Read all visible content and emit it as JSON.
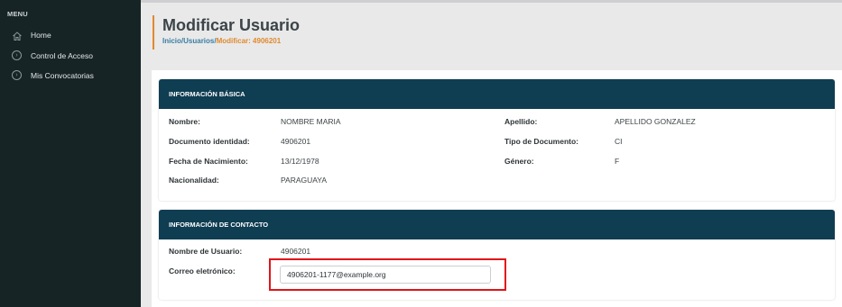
{
  "sidebar": {
    "menu_title": "MENU",
    "items": [
      {
        "label": "Home",
        "icon": "home-icon"
      },
      {
        "label": "Control de Acceso",
        "icon": "chevron-circle-icon"
      },
      {
        "label": "Mis Convocatorias",
        "icon": "chevron-circle-icon"
      }
    ]
  },
  "header": {
    "title": "Modificar Usuario",
    "breadcrumb": {
      "inicio": "Inicio",
      "sep": "/",
      "usuarios": "Usuarios",
      "current": "Modificar: 4906201"
    }
  },
  "basic_info": {
    "heading": "INFORMACIÓN BÁSICA",
    "nombre_label": "Nombre:",
    "nombre_value": "NOMBRE MARIA",
    "apellido_label": "Apellido:",
    "apellido_value": "APELLIDO GONZALEZ",
    "documento_label": "Documento identidad:",
    "documento_value": "4906201",
    "tipo_label": "Tipo de Documento:",
    "tipo_value": "CI",
    "fecha_label": "Fecha de Nacimiento:",
    "fecha_value": "13/12/1978",
    "genero_label": "Género:",
    "genero_value": "F",
    "nacionalidad_label": "Nacionalidad:",
    "nacionalidad_value": "PARAGUAYA"
  },
  "contact_info": {
    "heading": "INFORMACIÓN DE CONTACTO",
    "usuario_label": "Nombre de Usuario:",
    "usuario_value": "4906201",
    "correo_label": "Correo eletrónico:",
    "correo_value": "4906201-1177@example.org"
  },
  "colors": {
    "sidebar_bg": "#172426",
    "card_header": "#0f3d52",
    "accent": "#e08a2c",
    "highlight": "#e0141a"
  }
}
